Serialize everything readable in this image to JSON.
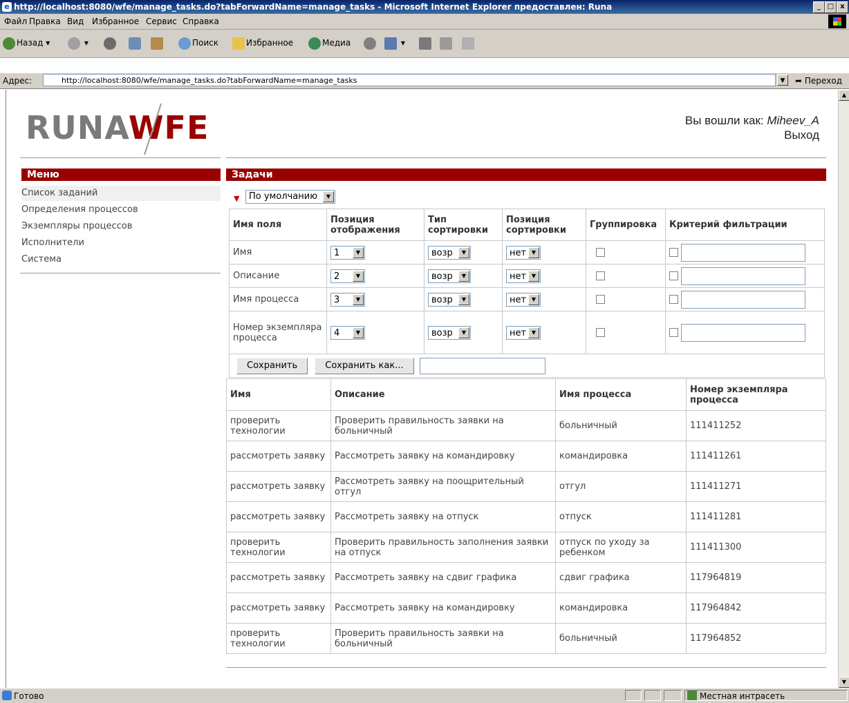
{
  "window": {
    "title": "http://localhost:8080/wfe/manage_tasks.do?tabForwardName=manage_tasks - Microsoft Internet Explorer предоставлен: Runa",
    "minimize": "_",
    "maximize": "□",
    "close": "x"
  },
  "menubar": [
    "Файл",
    "Правка",
    "Вид",
    "Избранное",
    "Сервис",
    "Справка"
  ],
  "toolbar": {
    "back": "Назад",
    "search": "Поиск",
    "favorites": "Избранное",
    "media": "Медиа"
  },
  "address": {
    "label": "Адрес:",
    "url": "http://localhost:8080/wfe/manage_tasks.do?tabForwardName=manage_tasks",
    "go": "Переход"
  },
  "header": {
    "logo_part1": "RUNA",
    "logo_part2": "WFE",
    "logged_in_as": "Вы вошли как:",
    "username": "Miheev_A",
    "logout": "Выход"
  },
  "sidebar": {
    "title": "Меню",
    "items": [
      {
        "label": "Список заданий"
      },
      {
        "label": "Определения процессов"
      },
      {
        "label": "Экземпляры процессов"
      },
      {
        "label": "Исполнители"
      },
      {
        "label": "Система"
      }
    ]
  },
  "main": {
    "title": "Задачи",
    "view_select": "По умолчанию",
    "settings": {
      "headers": {
        "field": "Имя поля",
        "position": "Позиция отображения",
        "sort_type": "Тип сортировки",
        "sort_pos": "Позиция сортировки",
        "group": "Группировка",
        "filter": "Критерий фильтрации"
      },
      "rows": [
        {
          "field": "Имя",
          "position": "1",
          "sort_type": "возр",
          "sort_pos": "нет"
        },
        {
          "field": "Описание",
          "position": "2",
          "sort_type": "возр",
          "sort_pos": "нет"
        },
        {
          "field": "Имя процесса",
          "position": "3",
          "sort_type": "возр",
          "sort_pos": "нет"
        },
        {
          "field": "Номер экземпляра процесса",
          "position": "4",
          "sort_type": "возр",
          "sort_pos": "нет"
        }
      ],
      "save": "Сохранить",
      "save_as": "Сохранить как..."
    },
    "tasks": {
      "headers": {
        "name": "Имя",
        "description": "Описание",
        "process": "Имя процесса",
        "instance": "Номер экземпляра процесса"
      },
      "rows": [
        {
          "name": "проверить технологии",
          "description": "Проверить правильность заявки на больничный",
          "process": "больничный",
          "instance": "111411252"
        },
        {
          "name": "рассмотреть заявку",
          "description": "Рассмотреть заявку на командировку",
          "process": "командировка",
          "instance": "111411261"
        },
        {
          "name": "рассмотреть заявку",
          "description": "Рассмотреть заявку на поощрительный отгул",
          "process": "отгул",
          "instance": "111411271"
        },
        {
          "name": "рассмотреть заявку",
          "description": "Рассмотреть заявку на отпуск",
          "process": "отпуск",
          "instance": "111411281"
        },
        {
          "name": "проверить технологии",
          "description": "Проверить правильность заполнения заявки на отпуск",
          "process": "отпуск по уходу за ребенком",
          "instance": "111411300"
        },
        {
          "name": "рассмотреть заявку",
          "description": "Рассмотреть заявку на сдвиг графика",
          "process": "сдвиг графика",
          "instance": "117964819"
        },
        {
          "name": "рассмотреть заявку",
          "description": "Рассмотреть заявку на командировку",
          "process": "командировка",
          "instance": "117964842"
        },
        {
          "name": "проверить технологии",
          "description": "Проверить правильность заявки на больничный",
          "process": "больничный",
          "instance": "117964852"
        }
      ]
    }
  },
  "statusbar": {
    "status": "Готово",
    "zone": "Местная интрасеть"
  }
}
